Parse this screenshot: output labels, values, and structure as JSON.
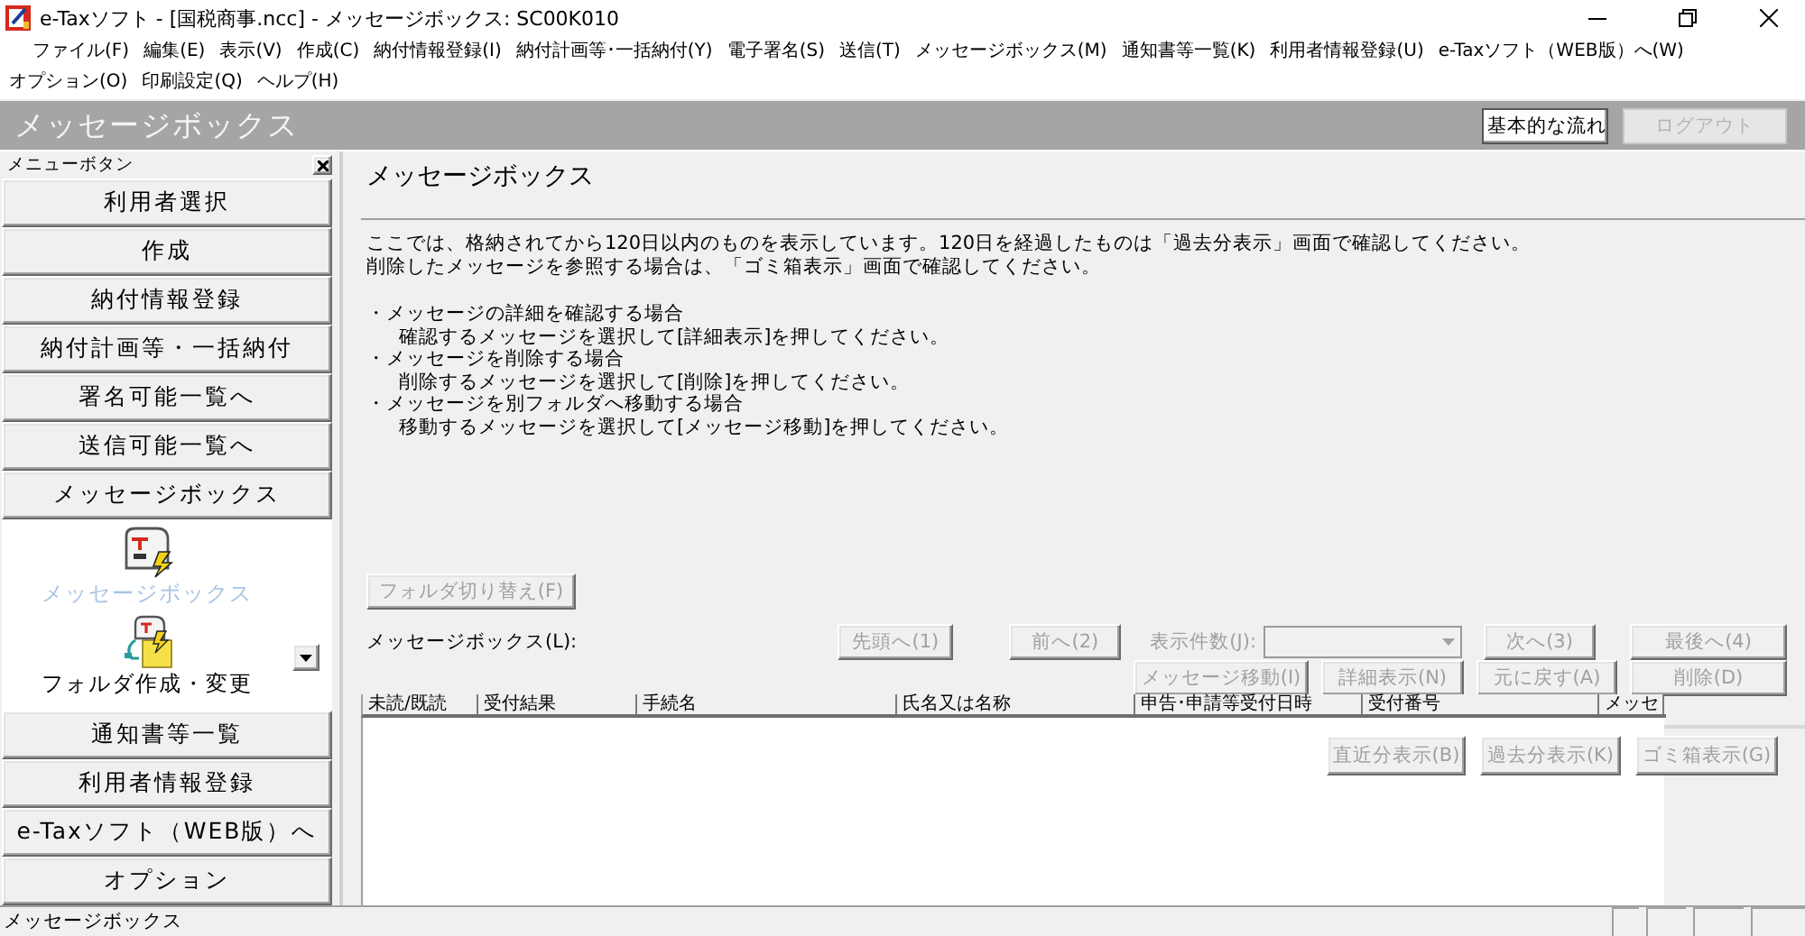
{
  "window": {
    "title": "e-Taxソフト - [国税商事.ncc] - メッセージボックス: SC00K010"
  },
  "menu_bar": {
    "rows": [
      [
        "ファイル(F)",
        "編集(E)",
        "表示(V)",
        "作成(C)",
        "納付情報登録(I)",
        "納付計画等･一括納付(Y)",
        "電子署名(S)",
        "送信(T)",
        "メッセージボックス(M)",
        "通知書等一覧(K)",
        "利用者情報登録(U)",
        "e-Taxソフト（WEB版）へ(W)"
      ],
      [
        "オプション(O)",
        "印刷設定(Q)",
        "ヘルプ(H)"
      ]
    ]
  },
  "header": {
    "title": "メッセージボックス",
    "buttons": [
      {
        "label": "基本的な流れ",
        "disabled": false
      },
      {
        "label": "ログアウト",
        "disabled": true
      }
    ]
  },
  "sidebar": {
    "title": "メニューボタン",
    "buttons_top": [
      "利用者選択",
      "作成",
      "納付情報登録",
      "納付計画等・一括納付",
      "署名可能一覧へ",
      "送信可能一覧へ",
      "メッセージボックス"
    ],
    "panel_items": [
      {
        "kind": "mailbox",
        "label": "メッセージボックス",
        "selected": true
      },
      {
        "kind": "folder",
        "label": "フォルダ作成・変更",
        "selected": false
      }
    ],
    "buttons_bottom": [
      "通知書等一覧",
      "利用者情報登録",
      "e-Taxソフト（WEB版）へ",
      "オプション"
    ]
  },
  "main": {
    "title": "メッセージボックス",
    "notes": [
      "ここでは、格納されてから120日以内のものを表示しています。120日を経過したものは「過去分表示」画面で確認してください。",
      "削除したメッセージを参照する場合は、「ゴミ箱表示」画面で確認してください。"
    ],
    "instructions": [
      {
        "heading": "・メッセージの詳細を確認する場合",
        "detail": "確認するメッセージを選択して[詳細表示]を押してください。"
      },
      {
        "heading": "・メッセージを削除する場合",
        "detail": "削除するメッセージを選択して[削除]を押してください。"
      },
      {
        "heading": "・メッセージを別フォルダへ移動する場合",
        "detail": "移動するメッセージを選択して[メッセージ移動]を押してください。"
      }
    ],
    "folder_button": {
      "label": "フォルダ切り替え(F)",
      "disabled": true
    }
  },
  "message_list": {
    "label": "メッセージボックス(L):",
    "nav_buttons": [
      {
        "label": "先頭へ(1)",
        "disabled": true
      },
      {
        "label": "前へ(2)",
        "disabled": true
      }
    ],
    "page_size": {
      "label": "表示件数(J):",
      "disabled": true
    },
    "nav_buttons_next": [
      {
        "label": "次へ(3)",
        "disabled": true
      },
      {
        "label": "最後へ(4)",
        "disabled": true
      }
    ],
    "actions": [
      {
        "label": "メッセージ移動(I)",
        "disabled": true
      },
      {
        "label": "詳細表示(N)",
        "disabled": true
      },
      {
        "label": "元に戻す(A)",
        "disabled": true
      },
      {
        "label": "削除(D)",
        "disabled": true
      }
    ],
    "columns": [
      "未読/既読",
      "受付結果",
      "手続名",
      "氏名又は名称",
      "申告･申請等受付日時",
      "受付番号",
      "メッセ"
    ],
    "view_buttons": [
      {
        "label": "直近分表示(B)",
        "disabled": true
      },
      {
        "label": "過去分表示(K)",
        "disabled": true
      },
      {
        "label": "ゴミ箱表示(G)",
        "disabled": true
      }
    ]
  },
  "status_bar": {
    "text": "メッセージボックス"
  }
}
